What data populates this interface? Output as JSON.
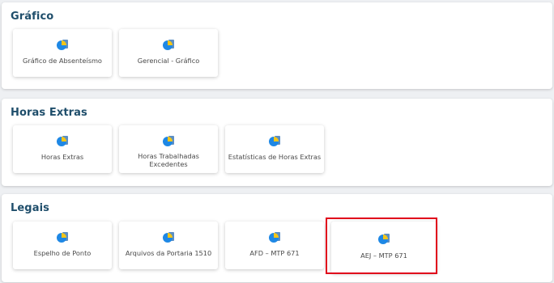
{
  "sections": [
    {
      "title": "Gráfico",
      "cards": [
        {
          "label": "Gráfico de Absenteísmo",
          "icon": "pie-chart-icon"
        },
        {
          "label": "Gerencial - Gráfico",
          "icon": "pie-chart-icon"
        }
      ]
    },
    {
      "title": "Horas Extras",
      "cards": [
        {
          "label": "Horas Extras",
          "icon": "pie-chart-icon"
        },
        {
          "label": "Horas Trabalhadas Excedentes",
          "icon": "pie-chart-icon"
        },
        {
          "label": "Estatísticas de Horas Extras",
          "icon": "pie-chart-icon"
        }
      ]
    },
    {
      "title": "Legais",
      "cards": [
        {
          "label": "Espelho de Ponto",
          "icon": "pie-chart-icon"
        },
        {
          "label": "Arquivos da Portaria 1510",
          "icon": "pie-chart-icon"
        },
        {
          "label": "AFD – MTP 671",
          "icon": "pie-chart-icon"
        },
        {
          "label": "AEJ – MTP 671",
          "icon": "pie-chart-icon"
        }
      ]
    }
  ],
  "colors": {
    "title": "#1f4e6b",
    "icon_blue": "#1e88e5",
    "icon_yellow": "#f5c518",
    "icon_doc": "#5c8fc4",
    "highlight": "#e0001b"
  },
  "highlighted_card": "AEJ – MTP 671"
}
